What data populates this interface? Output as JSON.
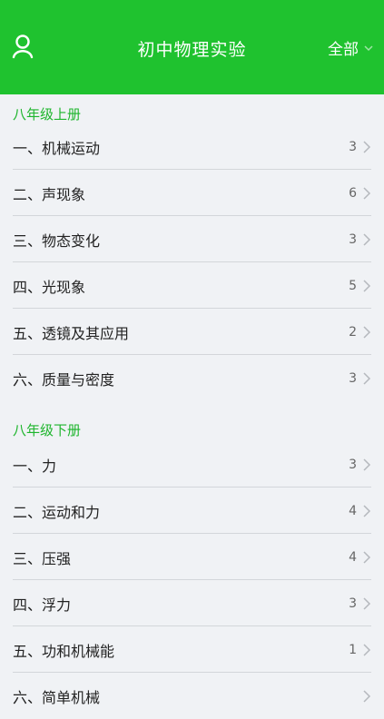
{
  "header": {
    "title": "初中物理实验",
    "filter_label": "全部",
    "colors": {
      "brand": "#1fc22f",
      "section": "#1db52c"
    },
    "icons": {
      "left": "user-icon",
      "filter": "chevron-down-icon"
    }
  },
  "sections": [
    {
      "title": "八年级上册",
      "items": [
        {
          "label": "一、机械运动",
          "count": "3"
        },
        {
          "label": "二、声现象",
          "count": "6"
        },
        {
          "label": "三、物态变化",
          "count": "3"
        },
        {
          "label": "四、光现象",
          "count": "5"
        },
        {
          "label": "五、透镜及其应用",
          "count": "2"
        },
        {
          "label": "六、质量与密度",
          "count": "3"
        }
      ]
    },
    {
      "title": "八年级下册",
      "items": [
        {
          "label": "一、力",
          "count": "3"
        },
        {
          "label": "二、运动和力",
          "count": "4"
        },
        {
          "label": "三、压强",
          "count": "4"
        },
        {
          "label": "四、浮力",
          "count": "3"
        },
        {
          "label": "五、功和机械能",
          "count": "1"
        },
        {
          "label": "六、简单机械",
          "count": ""
        }
      ]
    }
  ]
}
